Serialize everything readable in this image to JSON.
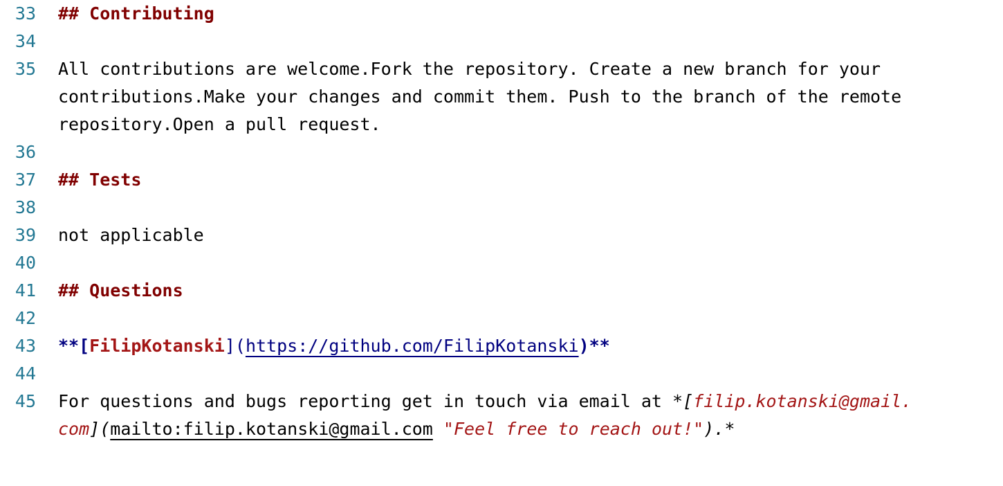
{
  "lines": [
    {
      "n": "33",
      "text": "## Contributing"
    },
    {
      "n": "34",
      "text": ""
    },
    {
      "n": "35",
      "wrap": [
        "All contributions are welcome.Fork the repository. Create a new branch for your",
        "contributions.Make your changes and commit them. Push to the branch of the remote",
        "repository.Open a pull request."
      ]
    },
    {
      "n": "36",
      "text": ""
    },
    {
      "n": "37",
      "text": "## Tests"
    },
    {
      "n": "38",
      "text": ""
    },
    {
      "n": "39",
      "text": "not applicable"
    },
    {
      "n": "40",
      "text": ""
    },
    {
      "n": "41",
      "text": "## Questions"
    },
    {
      "n": "42",
      "text": ""
    },
    {
      "n": "43",
      "parts": {
        "open": "**[",
        "label": "FilipKotanski",
        "mid": "](",
        "url": "https://github.com/FilipKotanski",
        "close": ")**"
      }
    },
    {
      "n": "44",
      "text": ""
    },
    {
      "n": "45",
      "parts": {
        "prefix": "For questions and bugs reporting get in touch via email at ",
        "star_open": "*[",
        "label_a": "filip.kotanski@gmail.",
        "label_b": "com",
        "mid": "](",
        "url": "mailto:filip.kotanski@gmail.com",
        "space": " ",
        "title": "\"Feel free to reach out!\"",
        "close": ").*"
      }
    }
  ]
}
